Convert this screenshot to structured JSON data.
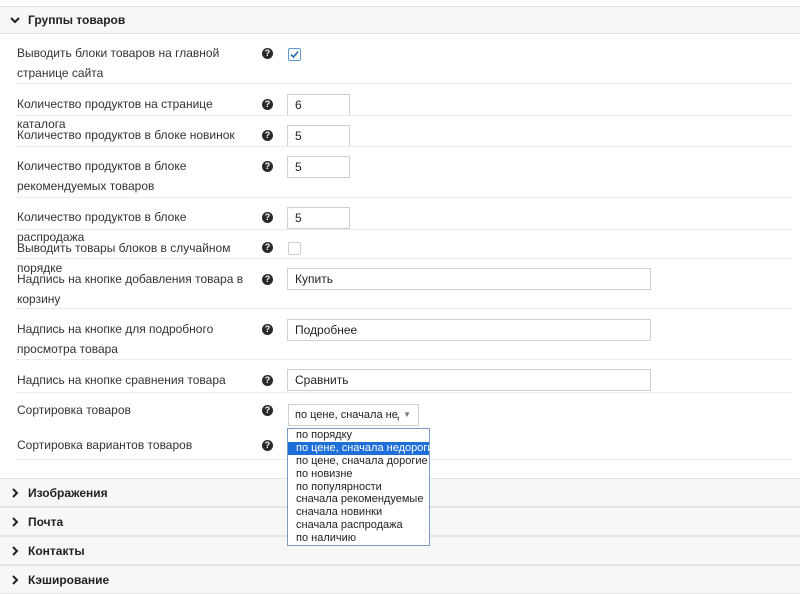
{
  "groups_section": {
    "title": "Группы товаров"
  },
  "fields": {
    "show_blocks_label": "Выводить блоки товаров на главной странице сайта",
    "catalog_count_label": "Количество продуктов на странице каталога",
    "catalog_count_value": "6",
    "new_count_label": "Количество продуктов в блоке новинок",
    "new_count_value": "5",
    "featured_count_label": "Количество продуктов в блоке рекомендуемых товаров",
    "featured_count_value": "5",
    "sale_count_label": "Количество продуктов в блоке распродажа",
    "sale_count_value": "5",
    "random_label": "Выводить товары блоков в случайном порядке",
    "buy_label": "Надпись на кнопке добавления товара в корзину",
    "buy_value": "Купить",
    "details_label": "Надпись на кнопке для подробного просмотра товара",
    "details_value": "Подробнее",
    "compare_label": "Надпись на кнопке сравнения товара",
    "compare_value": "Сравнить",
    "sort_label": "Сортировка товаров",
    "sort_value": "по цене, сначала недорогие",
    "variant_sort_label": "Сортировка вариантов товаров"
  },
  "help_glyph": "?",
  "sort_options": [
    "по порядку",
    "по цене, сначала недорогие",
    "по цене, сначала дорогие",
    "по новизне",
    "по популярности",
    "сначала рекомендуемые",
    "сначала новинки",
    "сначала распродажа",
    "по наличию"
  ],
  "sections": {
    "images": "Изображения",
    "mail": "Почта",
    "contacts": "Контакты",
    "cache": "Кэширование"
  },
  "colors": {
    "accent": "#1e6fd9",
    "check": "#2b6cb0"
  }
}
